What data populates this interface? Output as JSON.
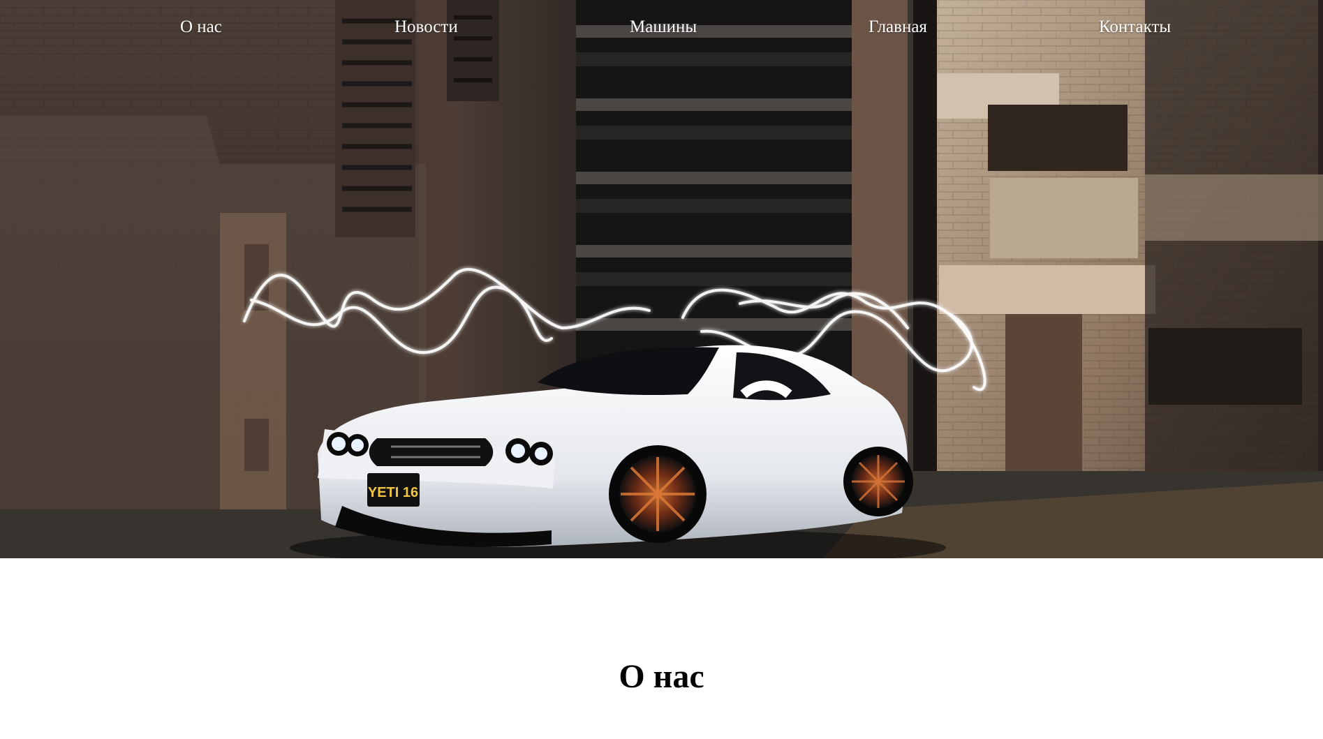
{
  "nav": {
    "items": [
      {
        "label": "О нас"
      },
      {
        "label": "Новости"
      },
      {
        "label": "Машины"
      },
      {
        "label": "Главная"
      },
      {
        "label": "Контакты"
      }
    ]
  },
  "hero": {
    "license_plate": "YETI 16"
  },
  "main": {
    "section_title": "О нас"
  },
  "colors": {
    "nav_text": "#ffffff",
    "title_text": "#000000",
    "page_background": "#ffffff"
  }
}
